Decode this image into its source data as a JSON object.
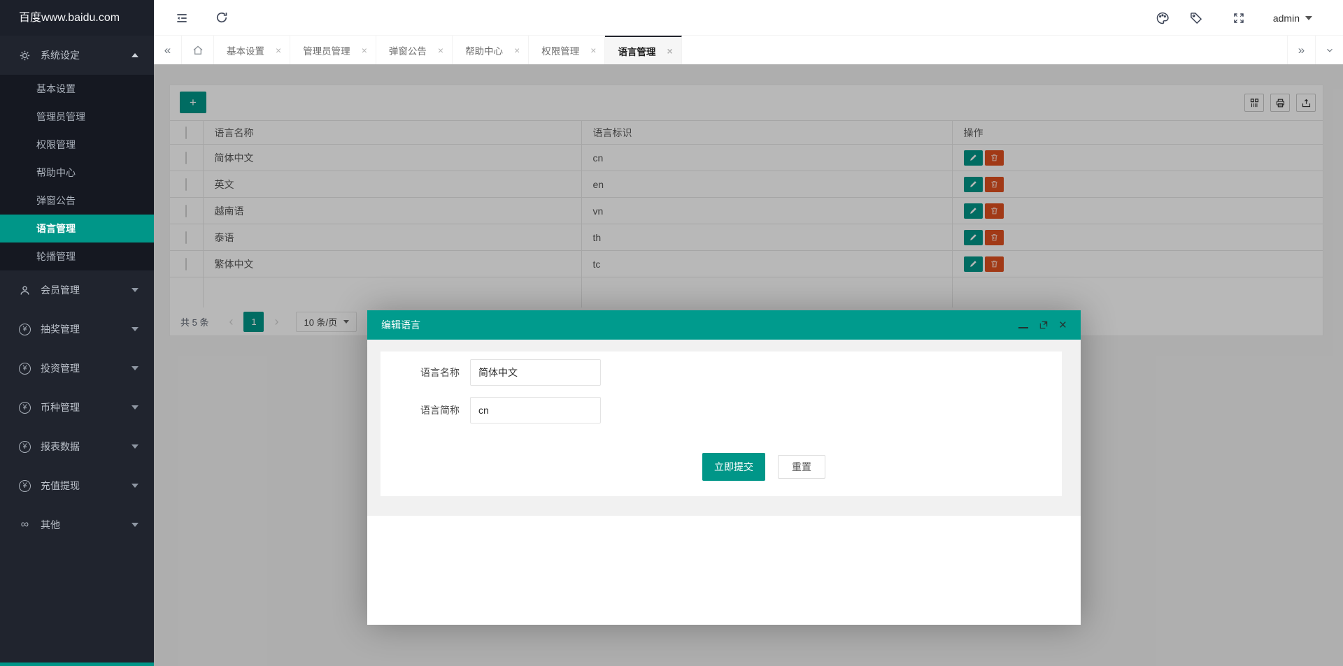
{
  "logo": "百度www.baidu.com",
  "topbar": {
    "user": "admin"
  },
  "tabbar": {
    "tabs": [
      "基本设置",
      "管理员管理",
      "弹窗公告",
      "帮助中心",
      "权限管理",
      "语言管理"
    ],
    "active": "语言管理"
  },
  "sidebar": {
    "system": {
      "label": "系统设定",
      "children": [
        "基本设置",
        "管理员管理",
        "权限管理",
        "帮助中心",
        "弹窗公告",
        "语言管理",
        "轮播管理"
      ],
      "active_child": "语言管理"
    },
    "groups": [
      {
        "label": "会员管理",
        "icon": "user-icon"
      },
      {
        "label": "抽奖管理",
        "icon": "yen-icon"
      },
      {
        "label": "投资管理",
        "icon": "yen-icon"
      },
      {
        "label": "币种管理",
        "icon": "yen-icon"
      },
      {
        "label": "报表数据",
        "icon": "yen-icon"
      },
      {
        "label": "充值提现",
        "icon": "yen-icon"
      },
      {
        "label": "其他",
        "icon": "link-icon"
      }
    ]
  },
  "toolbar": {
    "add_label": "+"
  },
  "table": {
    "columns": [
      "语言名称",
      "语言标识",
      "操作"
    ],
    "rows": [
      {
        "name": "简体中文",
        "code": "cn"
      },
      {
        "name": "英文",
        "code": "en"
      },
      {
        "name": "越南语",
        "code": "vn"
      },
      {
        "name": "泰语",
        "code": "th"
      },
      {
        "name": "繁体中文",
        "code": "tc"
      }
    ]
  },
  "pagination": {
    "total": "共 5 条",
    "current_page": "1",
    "page_size": "10 条/页"
  },
  "modal": {
    "title": "编辑语言",
    "fields": [
      {
        "label": "语言名称",
        "value": "简体中文"
      },
      {
        "label": "语言简称",
        "value": "cn"
      }
    ],
    "submit_label": "立即提交",
    "reset_label": "重置"
  },
  "colors": {
    "accent": "#009688",
    "danger": "#e0501f",
    "sidebar_bg": "#20242e",
    "submenu_bg": "#151821"
  }
}
